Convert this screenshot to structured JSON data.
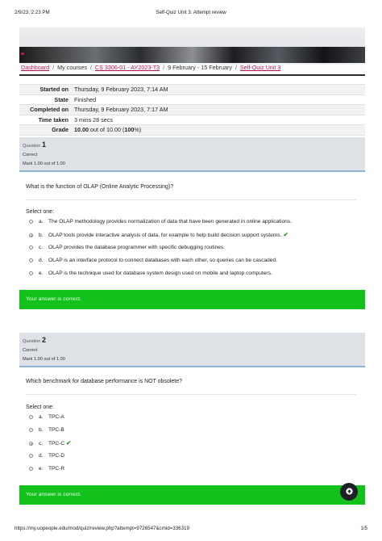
{
  "print_header": {
    "datetime": "2/9/23, 2:23 PM",
    "title": "Self-Quiz Unit 3: Attempt review"
  },
  "breadcrumb": {
    "dashboard": "Dashboard",
    "my_courses": "My courses",
    "course": "CS 3306-01 - AY2023-T3",
    "week": "9 February - 15 February",
    "quiz": "Self-Quiz Unit 3"
  },
  "summary": [
    {
      "label": "Started on",
      "value": "Thursday, 9 February 2023, 7:14 AM"
    },
    {
      "label": "State",
      "value": "Finished"
    },
    {
      "label": "Completed on",
      "value": "Thursday, 9 February 2023, 7:17 AM"
    },
    {
      "label": "Time taken",
      "value": "3 mins 28 secs"
    },
    {
      "label": "Grade",
      "value_bold": "10.00",
      "value_mid": " out of 10.00 (",
      "value_pct": "100",
      "value_end": "%)"
    }
  ],
  "questions": [
    {
      "label": "Question",
      "number": "1",
      "state": "Correct",
      "mark": "Mark 1.00 out of 1.00",
      "text": "What is the function of OLAP (Online Analytic Processing)?",
      "select_prompt": "Select one:",
      "options": [
        {
          "letter": "a.",
          "text": "The OLAP methodology provides normalization of data that have been generated in online applications."
        },
        {
          "letter": "b.",
          "text": "OLAP tools provide interactive analysis of data, for example to help build decision support systems.",
          "selected": true,
          "correct_mark": "✔"
        },
        {
          "letter": "c.",
          "text": "OLAP provides the database programmer with specific debugging routines."
        },
        {
          "letter": "d.",
          "text": "OLAP is an interface protocol to connect databases with each other, so queries can be cascaded."
        },
        {
          "letter": "e.",
          "text": "OLAP is the technique used for database system design used on mobile and laptop computers."
        }
      ],
      "feedback": "Your answer is correct."
    },
    {
      "label": "Question",
      "number": "2",
      "state": "Correct",
      "mark": "Mark 1.00 out of 1.00",
      "text": "Which benchmark for database performance is NOT obsolete?",
      "select_prompt": "Select one:",
      "options": [
        {
          "letter": "a.",
          "text": "TPC-A"
        },
        {
          "letter": "b.",
          "text": "TPC-B"
        },
        {
          "letter": "c.",
          "text": "TPC-C",
          "selected": true,
          "correct_mark": "✔"
        },
        {
          "letter": "d.",
          "text": "TPC-D"
        },
        {
          "letter": "e.",
          "text": "TPC-R"
        }
      ],
      "feedback": "Your answer is correct."
    }
  ],
  "back_to_top_icon": "arrow-up-icon",
  "colors": {
    "link": "#b5154f",
    "correct_feedback": "#12c21b",
    "check": "#2e9e2e",
    "question_info_bg": "#dee2e6"
  },
  "print_footer": {
    "url": "https://my.uopeople.edu/mod/quiz/review.php?attempt=9726547&cmid=336319",
    "page": "1/5"
  }
}
